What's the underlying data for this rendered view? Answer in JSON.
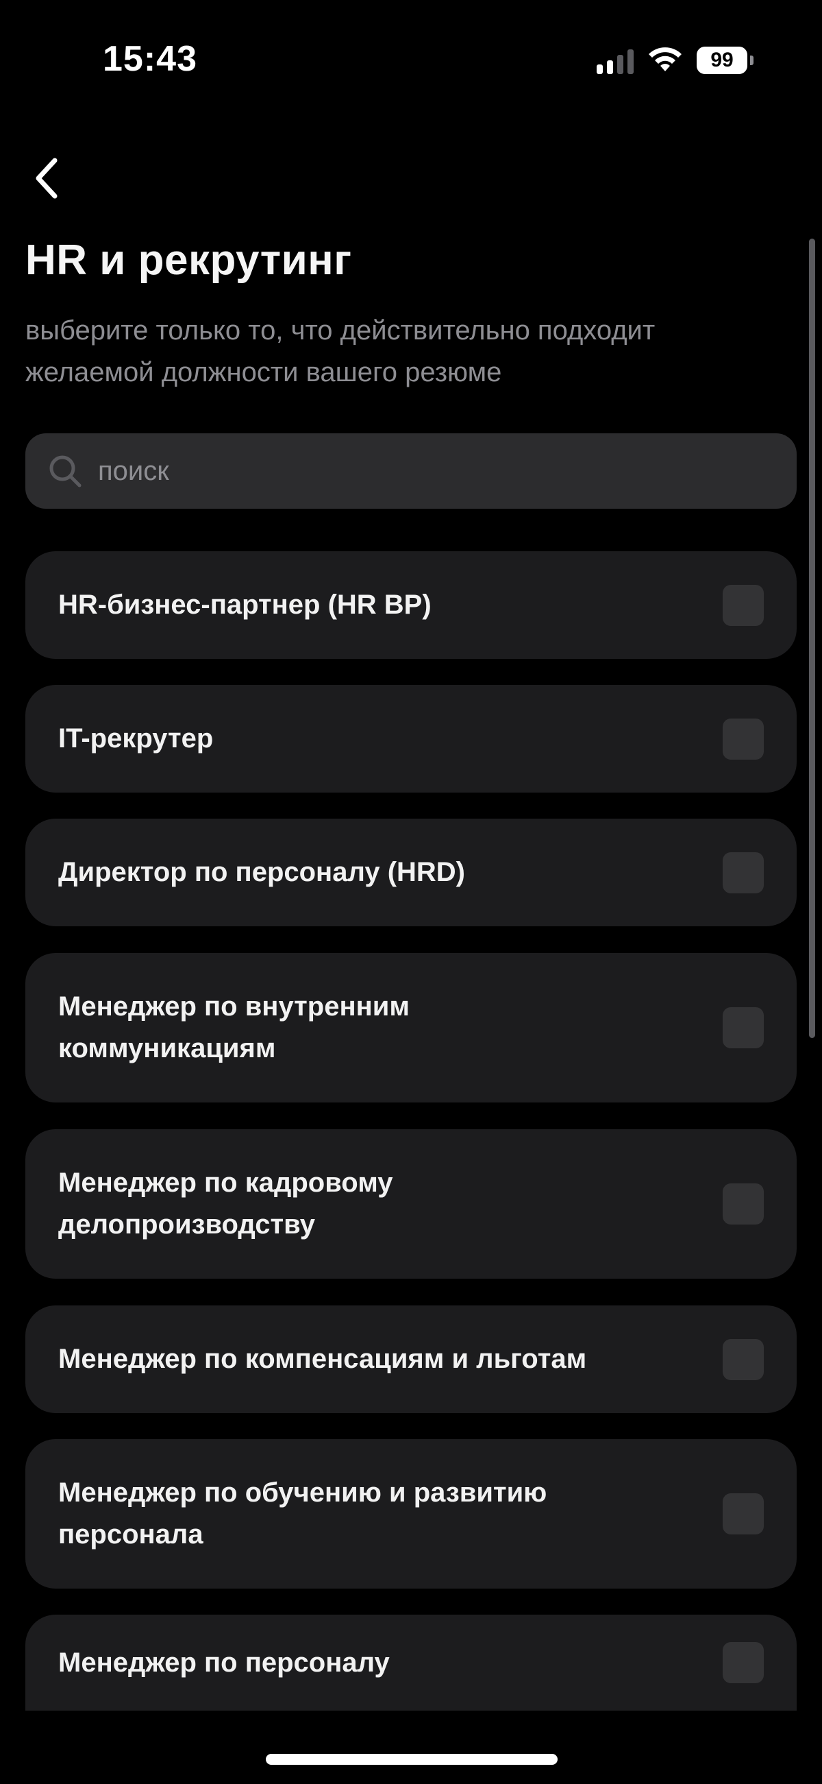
{
  "status_bar": {
    "time": "15:43",
    "battery": "99",
    "signal_icon": "cellular-signal-icon",
    "wifi_icon": "wifi-icon",
    "battery_icon": "battery-icon"
  },
  "header": {
    "back_icon": "chevron-left-icon",
    "title": "HR и рекрутинг",
    "subtitle": "выберите только то, что действительно подходит желаемой должности вашего резюме"
  },
  "search": {
    "placeholder": "поиск",
    "value": "",
    "icon": "search-icon"
  },
  "options": [
    {
      "label": "HR-бизнес-партнер (HR BP)",
      "checked": false
    },
    {
      "label": "IT-рекрутер",
      "checked": false
    },
    {
      "label": "Директор по персоналу (HRD)",
      "checked": false
    },
    {
      "label": "Менеджер по внутренним коммуникациям",
      "checked": false
    },
    {
      "label": "Менеджер по кадровому делопроизводству",
      "checked": false
    },
    {
      "label": "Менеджер по компенсациям и льготам",
      "checked": false
    },
    {
      "label": "Менеджер по обучению и развитию персонала",
      "checked": false
    },
    {
      "label": "Менеджер по персоналу",
      "checked": false
    }
  ],
  "colors": {
    "background": "#000000",
    "card": "#1c1c1e",
    "search_bg": "#2c2c2e",
    "checkbox": "#333335",
    "muted_text": "#8e8e93"
  }
}
